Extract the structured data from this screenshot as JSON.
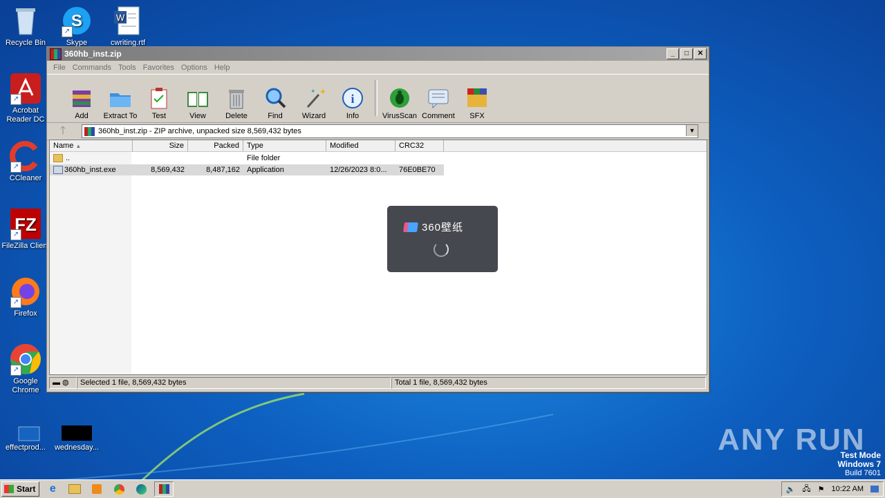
{
  "desktop": {
    "icons": [
      {
        "label": "Recycle Bin"
      },
      {
        "label": "Skype"
      },
      {
        "label": "cwriting.rtf"
      },
      {
        "label": "Acrobat Reader DC"
      },
      {
        "label": "CCleaner"
      },
      {
        "label": "FileZilla Client"
      },
      {
        "label": "Firefox"
      },
      {
        "label": "Google Chrome"
      },
      {
        "label": "effectprod..."
      },
      {
        "label": "wednesday..."
      }
    ]
  },
  "window": {
    "title": "360hb_inst.zip",
    "minimize": "_",
    "maximize": "□",
    "close": "✕",
    "menu": [
      "File",
      "Commands",
      "Tools",
      "Favorites",
      "Options",
      "Help"
    ],
    "toolbar": [
      "Add",
      "Extract To",
      "Test",
      "View",
      "Delete",
      "Find",
      "Wizard",
      "Info",
      "VirusScan",
      "Comment",
      "SFX"
    ],
    "address": "360hb_inst.zip - ZIP archive, unpacked size 8,569,432 bytes",
    "columns": [
      "Name",
      "Size",
      "Packed",
      "Type",
      "Modified",
      "CRC32"
    ],
    "rows": [
      {
        "name": "..",
        "size": "",
        "packed": "",
        "type": "File folder",
        "modified": "",
        "crc": ""
      },
      {
        "name": "360hb_inst.exe",
        "size": "8,569,432",
        "packed": "8,487,162",
        "type": "Application",
        "modified": "12/26/2023 8:0...",
        "crc": "76E0BE70"
      }
    ],
    "status_left": "Selected 1 file, 8,569,432 bytes",
    "status_right": "Total 1 file, 8,569,432 bytes"
  },
  "loader": {
    "brand": "360壁纸"
  },
  "taskbar": {
    "start": "Start",
    "clock": "10:22 AM"
  },
  "watermark": {
    "line1": "Test Mode",
    "line2": "Windows 7",
    "line3": "Build 7601",
    "logo": "ANY RUN"
  },
  "colors": {
    "desktop": "#0d5fc0",
    "window_chrome": "#d4d0c8",
    "loader_bg": "#45484e"
  }
}
